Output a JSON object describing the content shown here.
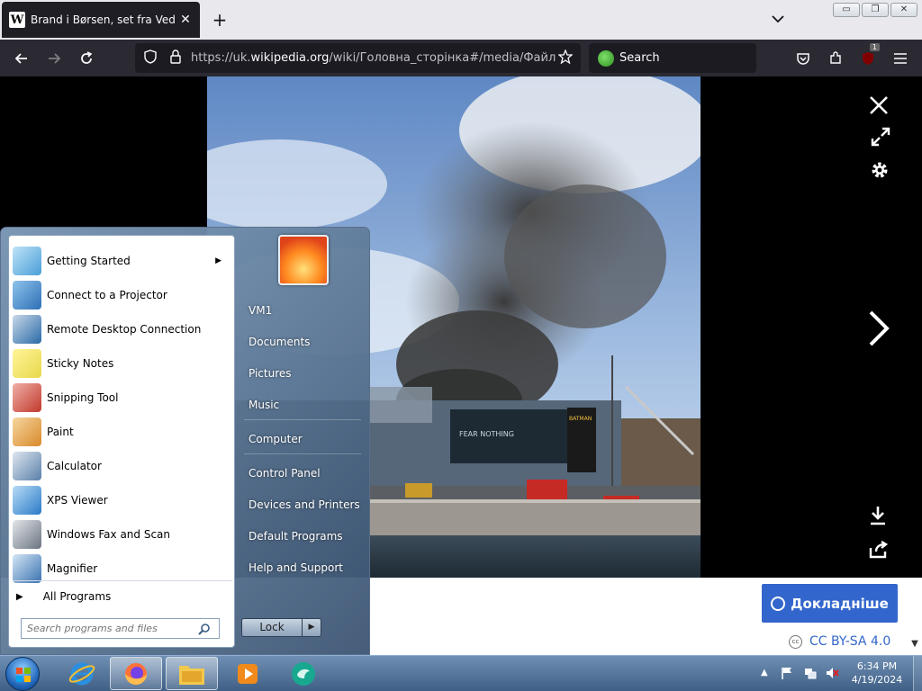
{
  "browser": {
    "tab": {
      "favicon": "W",
      "title": "Brand i Børsen, set fra Ved Stranden",
      "close": "✕"
    },
    "new_tab": "+",
    "window_buttons": {
      "minimize": "▭",
      "restore": "❐",
      "close": "✕"
    },
    "url": {
      "prefix": "https://uk.",
      "domain": "wikipedia.org",
      "path": "/wiki/Головна_сторінка#/media/Файл:Brand_i_Børsen"
    },
    "search_placeholder": "Search",
    "extension_badge": "1"
  },
  "media_viewer": {
    "details_button": "Докладніше",
    "license": "CC BY-SA 4.0",
    "license_icon": "cc",
    "photo_banner_text_left": "FEAR NOTHING",
    "photo_banner_text_right": "BATMAN"
  },
  "start_menu": {
    "programs": [
      {
        "label": "Getting Started",
        "icon": "getting-started-icon",
        "has_submenu": true
      },
      {
        "label": "Connect to a Projector",
        "icon": "projector-icon",
        "has_submenu": false
      },
      {
        "label": "Remote Desktop Connection",
        "icon": "remote-desktop-icon",
        "has_submenu": false
      },
      {
        "label": "Sticky Notes",
        "icon": "sticky-notes-icon",
        "has_submenu": false
      },
      {
        "label": "Snipping Tool",
        "icon": "snipping-tool-icon",
        "has_submenu": false
      },
      {
        "label": "Paint",
        "icon": "paint-icon",
        "has_submenu": false
      },
      {
        "label": "Calculator",
        "icon": "calculator-icon",
        "has_submenu": false
      },
      {
        "label": "XPS Viewer",
        "icon": "xps-viewer-icon",
        "has_submenu": false
      },
      {
        "label": "Windows Fax and Scan",
        "icon": "fax-scan-icon",
        "has_submenu": false
      },
      {
        "label": "Magnifier",
        "icon": "magnifier-icon",
        "has_submenu": false
      }
    ],
    "all_programs": "All Programs",
    "search_placeholder": "Search programs and files",
    "right_items": [
      "VM1",
      "Documents",
      "Pictures",
      "Music",
      "Computer",
      "Control Panel",
      "Devices and Printers",
      "Default Programs",
      "Help and Support"
    ],
    "lock_label": "Lock"
  },
  "taskbar": {
    "apps": [
      "internet-explorer-icon",
      "firefox-icon",
      "file-explorer-icon",
      "media-player-icon",
      "app-icon"
    ],
    "clock_time": "6:34 PM",
    "clock_date": "4/19/2024"
  },
  "colors": {
    "wiki_blue": "#3366cc",
    "firefox_toolbar": "#2b2a33",
    "tabbar": "#e8e8ed"
  }
}
